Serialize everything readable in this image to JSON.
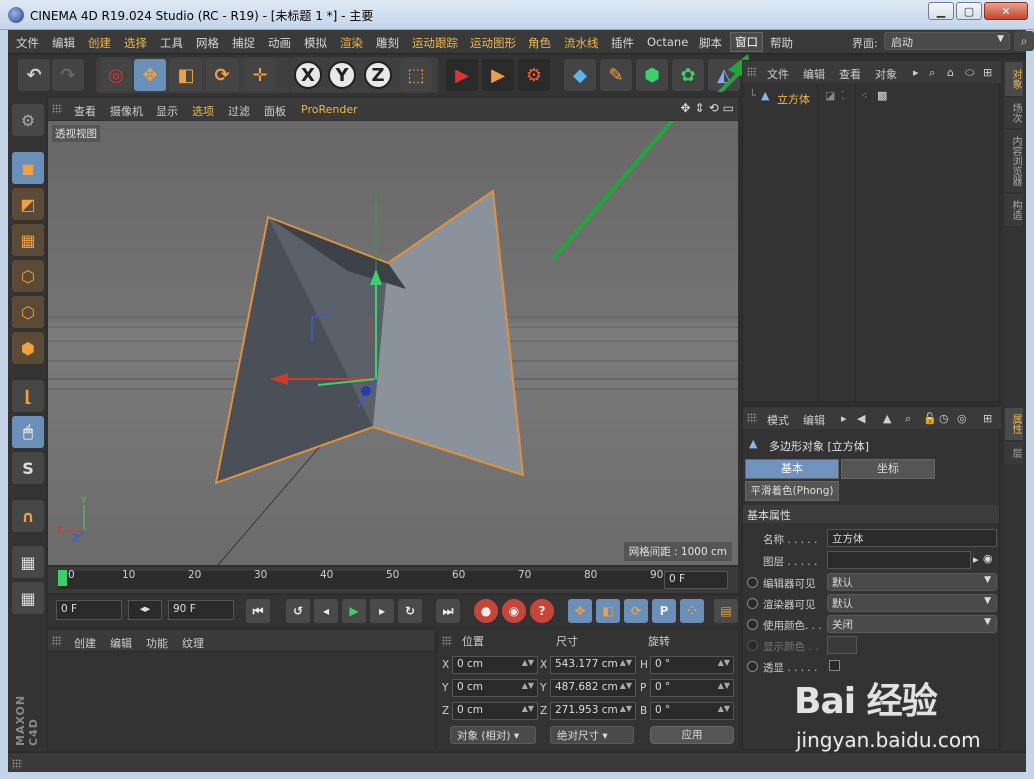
{
  "window": {
    "title": "CINEMA 4D R19.024 Studio (RC - R19) - [未标题 1 *] - 主要"
  },
  "menu": {
    "items": [
      "文件",
      "编辑",
      "创建",
      "选择",
      "工具",
      "网格",
      "捕捉",
      "动画",
      "模拟",
      "渲染",
      "雕刻",
      "运动跟踪",
      "运动图形",
      "角色",
      "流水线",
      "插件",
      "Octane",
      "脚本",
      "窗口",
      "帮助"
    ],
    "active": "窗口",
    "layout_label": "界面:",
    "layout_value": "启动"
  },
  "viewport": {
    "menu": [
      "查看",
      "摄像机",
      "显示",
      "选项",
      "过滤",
      "面板",
      "ProRender"
    ],
    "label": "透视视图",
    "grid_spacing": "网格间距 : 1000 cm"
  },
  "timeline": {
    "ticks": [
      "0",
      "10",
      "20",
      "30",
      "40",
      "50",
      "60",
      "70",
      "80",
      "90"
    ],
    "current_frame": "0 F"
  },
  "playback": {
    "start_frame": "0 F",
    "end_frame": "90 F"
  },
  "material_panel": {
    "menu": [
      "创建",
      "编辑",
      "功能",
      "纹理"
    ]
  },
  "coords": {
    "headers": [
      "位置",
      "尺寸",
      "旋转"
    ],
    "rows": [
      {
        "axis": "X",
        "pos": "0 cm",
        "size_axis": "X",
        "size": "543.177 cm",
        "rot_axis": "H",
        "rot": "0 °"
      },
      {
        "axis": "Y",
        "pos": "0 cm",
        "size_axis": "Y",
        "size": "487.682 cm",
        "rot_axis": "P",
        "rot": "0 °"
      },
      {
        "axis": "Z",
        "pos": "0 cm",
        "size_axis": "Z",
        "size": "271.953 cm",
        "rot_axis": "B",
        "rot": "0 °"
      }
    ],
    "mode_dd": "对象 (相对)",
    "size_dd": "绝对尺寸",
    "apply": "应用"
  },
  "object_manager": {
    "menu": [
      "文件",
      "编辑",
      "查看",
      "对象"
    ],
    "objects": [
      {
        "name": "立方体"
      }
    ]
  },
  "attributes": {
    "menu": [
      "模式",
      "编辑"
    ],
    "title": "多边形对象 [立方体]",
    "tabs": [
      "基本",
      "坐标"
    ],
    "phong_tab": "平滑着色(Phong)",
    "section": "基本属性",
    "fields": [
      {
        "label": "名称 . . . . .",
        "value": "立方体",
        "kind": "text"
      },
      {
        "label": "图层 . . . . .",
        "value": "",
        "kind": "text"
      },
      {
        "label": "编辑器可见",
        "value": "默认",
        "kind": "dd"
      },
      {
        "label": "渲染器可见",
        "value": "默认",
        "kind": "dd"
      },
      {
        "label": "使用颜色. . .",
        "value": "关闭",
        "kind": "dd"
      },
      {
        "label": "显示颜色 . .",
        "value": "",
        "kind": "color"
      },
      {
        "label": "透显 . . . . .",
        "value": "",
        "kind": "check"
      }
    ]
  },
  "right_tabs": [
    "对象",
    "场次",
    "内容浏览器",
    "构造",
    "属性",
    "层"
  ],
  "watermark": {
    "brand": "Bai 经验",
    "url": "jingyan.baidu.com"
  },
  "colors": {
    "accent": "#f0b84a",
    "selection": "#6a8fb8",
    "object_outline": "#e0913a",
    "arrow": "#1fa83a"
  }
}
